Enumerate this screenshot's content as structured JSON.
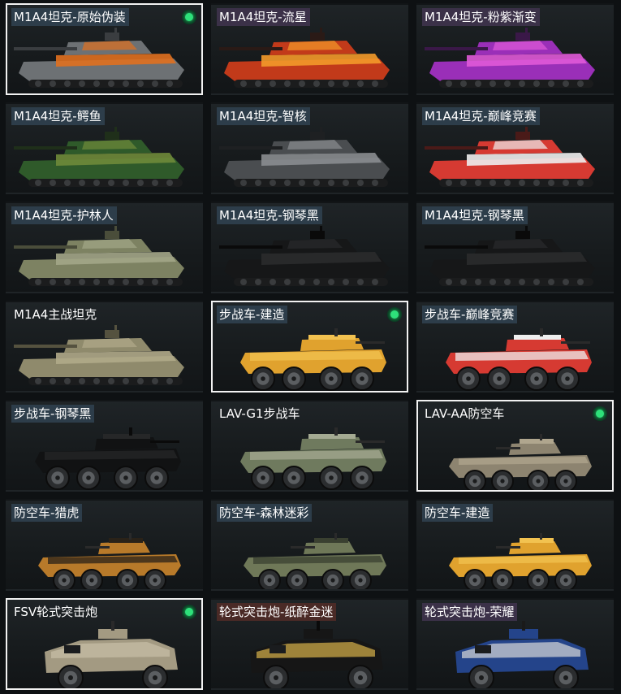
{
  "skins": [
    {
      "label": "M1A4坦克-原始伪装",
      "type": "tank",
      "tag": "blue",
      "selected": true,
      "equipped": true,
      "colors": [
        "#6d7174",
        "#e0701f",
        "#3a3d40"
      ]
    },
    {
      "label": "M1A4坦克-流星",
      "type": "tank",
      "tag": "purple",
      "selected": false,
      "equipped": false,
      "colors": [
        "#c23a1a",
        "#f39a2a",
        "#2a1a16"
      ]
    },
    {
      "label": "M1A4坦克-粉紫渐变",
      "type": "tank",
      "tag": "purple",
      "selected": false,
      "equipped": false,
      "colors": [
        "#9a2fb8",
        "#e05ad8",
        "#3a1848"
      ]
    },
    {
      "label": "M1A4坦克-鳄鱼",
      "type": "tank",
      "tag": "blue",
      "selected": false,
      "equipped": false,
      "colors": [
        "#2f5a2a",
        "#6f8a3a",
        "#1f2f1a"
      ]
    },
    {
      "label": "M1A4坦克-智核",
      "type": "tank",
      "tag": "blue",
      "selected": false,
      "equipped": false,
      "colors": [
        "#4a4d50",
        "#8a8d90",
        "#1e2022"
      ]
    },
    {
      "label": "M1A4坦克-巅峰竞赛",
      "type": "tank",
      "tag": "blue",
      "selected": false,
      "equipped": false,
      "colors": [
        "#d63a32",
        "#eeeeee",
        "#4a1a18"
      ]
    },
    {
      "label": "M1A4坦克-护林人",
      "type": "tank",
      "tag": "blue",
      "selected": false,
      "equipped": false,
      "colors": [
        "#7d8262",
        "#a3a688",
        "#4a4d3a"
      ]
    },
    {
      "label": "M1A4坦克-钢琴黑",
      "type": "tank",
      "tag": "blue",
      "selected": false,
      "equipped": false,
      "colors": [
        "#161718",
        "#2a2b2c",
        "#0a0a0a"
      ]
    },
    {
      "label": "M1A4坦克-钢琴黑",
      "type": "tank",
      "tag": "blue",
      "selected": false,
      "equipped": false,
      "colors": [
        "#161718",
        "#2a2b2c",
        "#0a0a0a"
      ]
    },
    {
      "label": "M1A4主战坦克",
      "type": "tank",
      "tag": "none",
      "selected": false,
      "equipped": false,
      "colors": [
        "#8f8a6c",
        "#b0aa8a",
        "#55523f"
      ]
    },
    {
      "label": "步战车-建造",
      "type": "ifv",
      "tag": "blue",
      "selected": true,
      "equipped": true,
      "colors": [
        "#e0a22e",
        "#f2c250",
        "#2a2a2a"
      ]
    },
    {
      "label": "步战车-巅峰竞赛",
      "type": "ifv",
      "tag": "blue",
      "selected": false,
      "equipped": false,
      "colors": [
        "#d63a32",
        "#eeeeee",
        "#2a2a2a"
      ]
    },
    {
      "label": "步战车-钢琴黑",
      "type": "ifv",
      "tag": "blue",
      "selected": false,
      "equipped": false,
      "colors": [
        "#111213",
        "#262728",
        "#0a0a0a"
      ]
    },
    {
      "label": "LAV-G1步战车",
      "type": "ifv",
      "tag": "none",
      "selected": false,
      "equipped": false,
      "colors": [
        "#6f7a5e",
        "#a4aa92",
        "#2a2a2a"
      ]
    },
    {
      "label": "LAV-AA防空车",
      "type": "aa",
      "tag": "none",
      "selected": true,
      "equipped": true,
      "colors": [
        "#8d8470",
        "#b0a68e",
        "#2a2a2a"
      ]
    },
    {
      "label": "防空车-猎虎",
      "type": "aa",
      "tag": "blue",
      "selected": false,
      "equipped": false,
      "colors": [
        "#b87a2a",
        "#2a2218",
        "#2a2a2a"
      ]
    },
    {
      "label": "防空车-森林迷彩",
      "type": "aa",
      "tag": "blue",
      "selected": false,
      "equipped": false,
      "colors": [
        "#6f7858",
        "#3a4030",
        "#2a2a2a"
      ]
    },
    {
      "label": "防空车-建造",
      "type": "aa",
      "tag": "blue",
      "selected": false,
      "equipped": false,
      "colors": [
        "#e0a22e",
        "#f2c250",
        "#2a2a2a"
      ]
    },
    {
      "label": "FSV轮式突击炮",
      "type": "fsv",
      "tag": "none",
      "selected": true,
      "equipped": true,
      "colors": [
        "#a39a82",
        "#c8bfa6",
        "#2a2a2a"
      ]
    },
    {
      "label": "轮式突击炮-纸醉金迷",
      "type": "fsv",
      "tag": "red",
      "selected": false,
      "equipped": false,
      "colors": [
        "#161616",
        "#d8b24a",
        "#0a0a0a"
      ]
    },
    {
      "label": "轮式突击炮-荣耀",
      "type": "fsv",
      "tag": "purple",
      "selected": false,
      "equipped": false,
      "colors": [
        "#24448a",
        "#d8d8d8",
        "#1a1a1a"
      ]
    }
  ]
}
